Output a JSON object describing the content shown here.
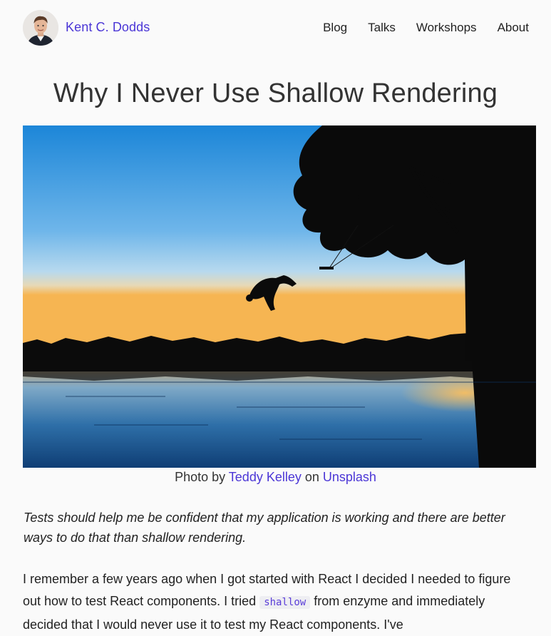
{
  "header": {
    "site_name": "Kent C. Dodds",
    "nav": [
      {
        "label": "Blog"
      },
      {
        "label": "Talks"
      },
      {
        "label": "Workshops"
      },
      {
        "label": "About"
      }
    ]
  },
  "article": {
    "title": "Why I Never Use Shallow Rendering",
    "caption": {
      "prefix": "Photo by ",
      "author": "Teddy Kelley",
      "middle": " on ",
      "source": "Unsplash"
    },
    "lead": "Tests should help me be confident that my application is working and there are better ways to do that than shallow rendering.",
    "para1": {
      "before": "I remember a few years ago when I got started with React I decided I needed to figure out how to test React components. I tried ",
      "code": "shallow",
      "after": " from enzyme and immediately decided that I would never use it to test my React components. I've"
    }
  },
  "colors": {
    "link": "#4b36d6",
    "background": "#fafafa",
    "code_text": "#5a3dd8",
    "code_bg": "#eeeef2"
  }
}
